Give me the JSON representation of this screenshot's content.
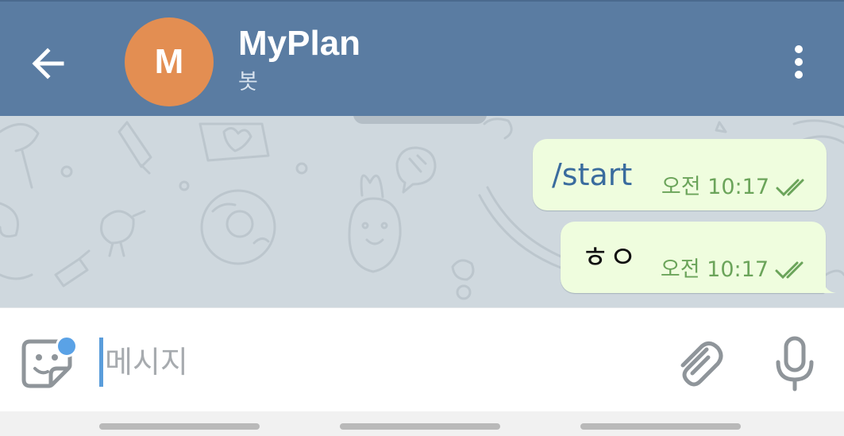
{
  "header": {
    "back_icon": "arrow-left-icon",
    "avatar_initial": "M",
    "avatar_color": "#e38e52",
    "title": "MyPlan",
    "subtitle": "봇",
    "menu_icon": "more-vertical-icon",
    "background_color": "#5a7ca2"
  },
  "messages": [
    {
      "text": "/start",
      "time": "오전 10:17",
      "status_icon": "double-check-icon",
      "text_color": "#3a6c9e"
    },
    {
      "text": "ㅎㅇ",
      "time": "오전 10:17",
      "status_icon": "double-check-icon",
      "text_color": "#111111"
    }
  ],
  "composer": {
    "sticker_icon": "sticker-icon",
    "placeholder": "메시지",
    "attach_icon": "paperclip-icon",
    "mic_icon": "microphone-icon",
    "badge_color": "#5aa2e6"
  },
  "colors": {
    "bubble_background": "#effdde",
    "timestamp_color": "#6ba45a",
    "chat_background": "#cfd8de"
  }
}
